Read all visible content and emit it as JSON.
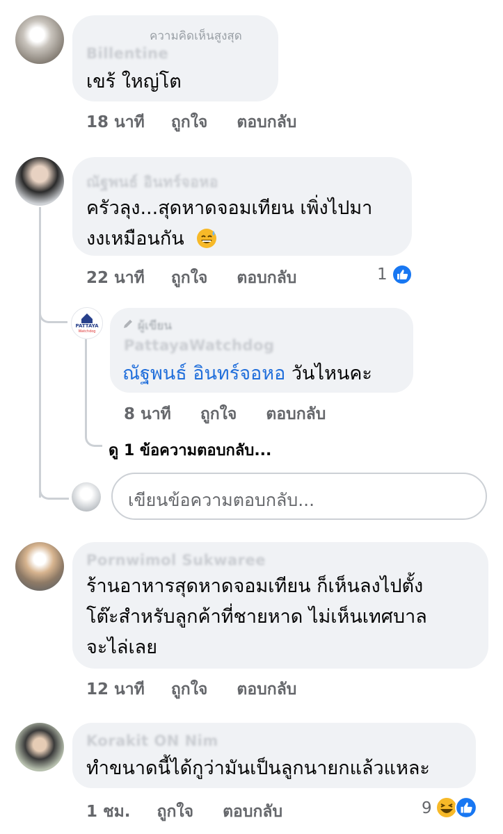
{
  "comments": [
    {
      "name": "Billentine",
      "badge": "ความคิดเห็นสูงสุด",
      "text": "เขร้ ใหญ่โต",
      "time": "18 นาที",
      "like_label": "ถูกใจ",
      "reply_label": "ตอบกลับ"
    },
    {
      "name": "ณัฐพนธ์ อินทร์จอหอ",
      "lines": [
        "ครัวลุง...สุดหาดจอมเทียน เพิ่งไปมา",
        "งงเหมือนกัน"
      ],
      "emoji": "sweat-smile",
      "time": "22 นาที",
      "like_label": "ถูกใจ",
      "reply_label": "ตอบกลับ",
      "reaction_count": "1",
      "reaction_icons": [
        "like"
      ]
    },
    {
      "badge": "ผู้เขียน",
      "name": "PattayaWatchdog",
      "avatar_text": "PATTAYA",
      "avatar_subtext": "Watchdog",
      "mention": "ณัฐพนธ์ อินทร์จอหอ",
      "text": " วันไหนคะ",
      "time": "8 นาที",
      "like_label": "ถูกใจ",
      "reply_label": "ตอบกลับ"
    },
    {
      "name": "Pornwimol Sukwaree",
      "lines": [
        "ร้านอาหารสุดหาดจอมเทียน ก็เห็นลงไปตั้ง",
        "โต๊ะสำหรับลูกค้าที่ชายหาด ไม่เห็นเทศบาล",
        "จะไล่เลย"
      ],
      "time": "12 นาที",
      "like_label": "ถูกใจ",
      "reply_label": "ตอบกลับ"
    },
    {
      "name": "Korakit ON Nim",
      "text": "ทำขนาดนี้ได้กูว่ามันเป็นลูกนายกแล้วแหละ",
      "time": "1 ชม.",
      "like_label": "ถูกใจ",
      "reply_label": "ตอบกลับ",
      "reaction_count": "9",
      "reaction_icons": [
        "haha",
        "like"
      ]
    }
  ],
  "view_replies": "ดู 1 ข้อความตอบกลับ...",
  "reply_input": {
    "placeholder": "เขียนข้อความตอบกลับ..."
  },
  "colors": {
    "bubble": "#f0f2f5",
    "link": "#216fdb",
    "meta": "#65676b",
    "like_blue": "#1877f2",
    "haha_yellow": "#f7b928"
  }
}
